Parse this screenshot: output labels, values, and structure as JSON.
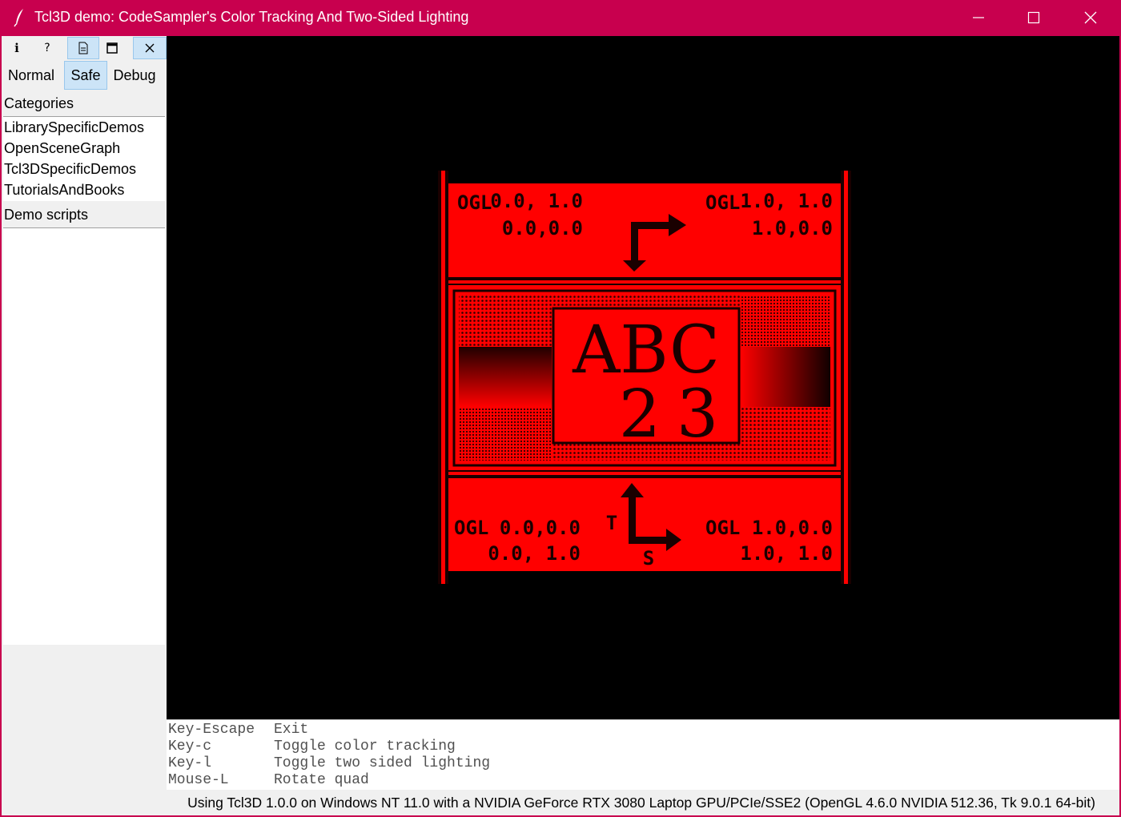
{
  "window": {
    "title": "Tcl3D demo: CodeSampler's Color Tracking And Two-Sided Lighting",
    "controls": [
      "minimize",
      "maximize",
      "close"
    ]
  },
  "toolbar": {
    "buttons": [
      {
        "icon": "info-icon",
        "glyph": "i"
      },
      {
        "icon": "help-icon",
        "glyph": "?"
      },
      {
        "icon": "document-icon"
      },
      {
        "icon": "window-icon"
      },
      {
        "icon": "close-icon"
      }
    ]
  },
  "modes": {
    "normal": "Normal",
    "safe": "Safe",
    "debug": "Debug",
    "selected": "Safe"
  },
  "categories": {
    "label": "Categories",
    "items": [
      "LibrarySpecificDemos",
      "OpenSceneGraph",
      "Tcl3DSpecificDemos",
      "TutorialsAndBooks"
    ]
  },
  "demo_scripts": {
    "label": "Demo scripts",
    "items": []
  },
  "texture": {
    "top_left": [
      "OGL",
      "0.0, 1.0",
      "0.0,0.0"
    ],
    "top_right": [
      "OGL",
      "1.0, 1.0",
      "1.0,0.0"
    ],
    "bottom_left": [
      "OGL",
      "0.0,0.0",
      "0.0, 1.0"
    ],
    "bottom_right": [
      "OGL",
      "1.0,0.0",
      "1.0, 1.0"
    ],
    "center_line1": "ABC",
    "center_line2": "23",
    "axis_t": "T",
    "axis_s": "S",
    "tint": "#ff0000"
  },
  "help": [
    {
      "key": "Key-Escape",
      "action": "Exit"
    },
    {
      "key": "Key-c",
      "action": "Toggle color tracking"
    },
    {
      "key": "Key-l",
      "action": "Toggle two sided lighting"
    },
    {
      "key": "Mouse-L",
      "action": "Rotate quad"
    }
  ],
  "status": "Using Tcl3D 1.0.0 on Windows NT 11.0 with a NVIDIA GeForce RTX 3080 Laptop GPU/PCIe/SSE2 (OpenGL 4.6.0 NVIDIA 512.36, Tk 9.0.1 64-bit)",
  "colors": {
    "titlebar": "#c8004e",
    "selected_bg": "#cce4f7",
    "canvas_bg": "#000000"
  }
}
